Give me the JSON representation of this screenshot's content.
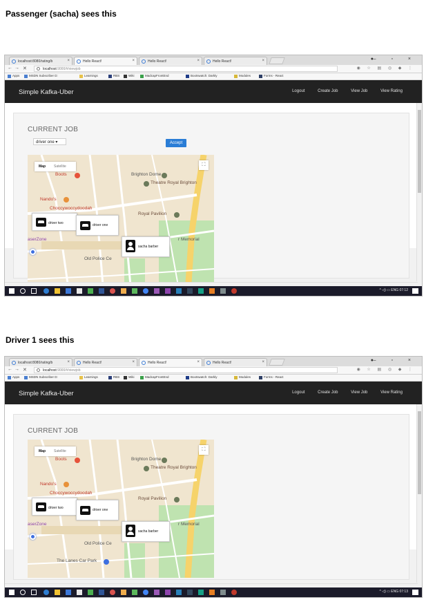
{
  "captions": [
    "Passenger (sacha) sees this",
    "Driver 1 sees this"
  ],
  "browser": {
    "tabs": [
      "localhost:8080/rating/b",
      "Hello React!",
      "Hello React!",
      "Hello React!"
    ],
    "close_glyph": "×",
    "url_host": "localhost",
    "url_path": ":9000/#/viewjob",
    "window_controls": "– ▫ ×",
    "bookmarks": [
      "Apps",
      "MSDN Subscriber D:",
      "Learnings",
      "RBS",
      "Wiki",
      "MadcapFrontEnd",
      "Bootswatch: Darkly",
      "Modules",
      "Forms - React"
    ]
  },
  "app": {
    "brand": "Simple Kafka-Uber",
    "nav": [
      "Logout",
      "Create Job",
      "View Job",
      "View Rating"
    ],
    "current_job_title": "CURRENT JOB",
    "driver_select_value": "driver one ▾",
    "accept_label": "Accept"
  },
  "map": {
    "ctrl_map": "Map",
    "ctrl_satellite": "Satellite",
    "fullscreen_glyph": "⛶",
    "labels": {
      "boots": "Boots",
      "brighton_dome": "Brighton Dome",
      "theatre": "Theatre Royal Brighton",
      "nandos": "Nando's",
      "choccy": "Choccywoccydoodah",
      "pavilion": "Royal Pavilion",
      "laserzone": "aserZone",
      "war_memorial": "r Memorial",
      "old_police": "Old Police Ce",
      "lanes": "The Lanes Car Park"
    },
    "marker_driver_two": "driver two",
    "marker_driver_one": "driver one",
    "marker_sacha": "sacha barber"
  },
  "taskbar": {
    "tray_lang": "ENG",
    "times": [
      "07:12",
      "07:13"
    ]
  },
  "colors": {
    "navbar": "#222222",
    "accept": "#2a7dd6",
    "map_bg": "#f0e5cf",
    "road_yellow": "#f6d36b",
    "park_green": "#bfe3b0"
  }
}
